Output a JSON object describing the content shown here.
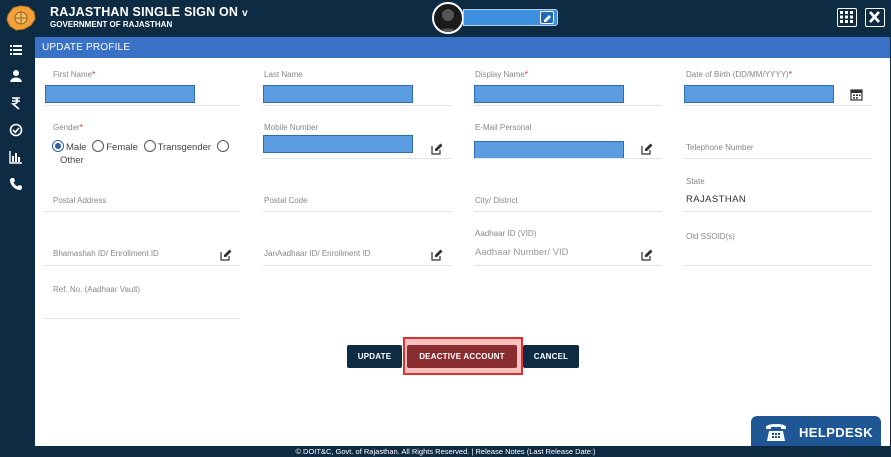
{
  "brand": {
    "title": "RAJASTHAN SINGLE SIGN ON",
    "caret": "v",
    "subtitle": "GOVERNMENT OF RAJASTHAN"
  },
  "section_title": "UPDATE PROFILE",
  "fields": {
    "first_name": "First Name",
    "last_name": "Last Name",
    "display_name": "Display Name",
    "dob": "Date of Birth (DD/MM/YYYY)",
    "gender": "Gender",
    "mobile": "Mobile Number",
    "email": "E-Mail Personal",
    "telephone": "Telephone Number",
    "postal_address": "Postal Address",
    "postal_code": "Postal Code",
    "city": "City/ District",
    "state": "State",
    "state_value": "RAJASTHAN",
    "bhamashah": "Bhamashah ID/ Enrollment ID",
    "janaadhaar": "JanAadhaar ID/ Enrollment ID",
    "aadhaar": "Aadhaar ID (VID)",
    "aadhaar_placeholder": "Aadhaar Number/ VID",
    "old_ssoid": "Old SSOID(s)",
    "ref_no": "Ref. No. (Aadhaar Vault)"
  },
  "required_mark": "*",
  "gender_options": [
    "Male",
    "Female",
    "Transgender",
    "Other"
  ],
  "gender_selected": "Male",
  "buttons": {
    "update": "UPDATE",
    "deactivate": "DEACTIVE ACCOUNT",
    "cancel": "CANCEL"
  },
  "helpdesk": "HELPDESK",
  "footer": "© DOIT&C, Govt. of Rajasthan. All Rights Reserved.  |  Release Notes (Last Release Date:)",
  "colors": {
    "navy": "#0d2c44",
    "header_blue": "#3871c6",
    "danger": "#8a2d31",
    "highlight": "#e03030"
  }
}
